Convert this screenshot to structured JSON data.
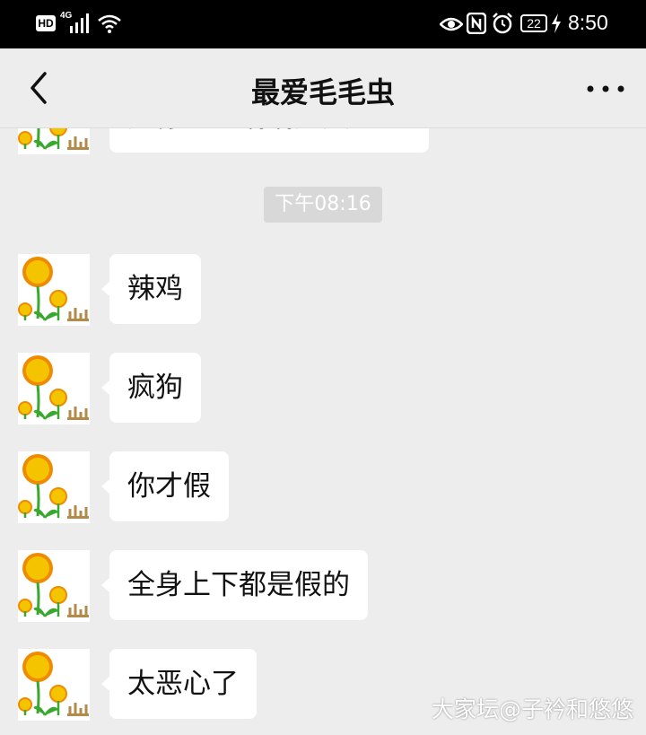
{
  "status_bar": {
    "hd_label": "HD",
    "network_label": "4G",
    "battery_level": "22",
    "time": "8:50"
  },
  "nav": {
    "title": "最爱毛毛虫",
    "back_icon": "chevron-left-icon",
    "more_icon": "more-dots-icon"
  },
  "chat": {
    "partial_message": "是你一直嘀嘀是天吧。",
    "timestamp": "下午08:16",
    "messages": [
      {
        "text": "辣鸡"
      },
      {
        "text": "疯狗"
      },
      {
        "text": "你才假"
      },
      {
        "text": "全身上下都是假的"
      },
      {
        "text": "太恶心了"
      }
    ]
  },
  "watermark": "大家坛@子衿和悠悠",
  "colors": {
    "background": "#ededed",
    "status_bar": "#000000",
    "bubble": "#ffffff",
    "timestamp_bg": "#d8d8d8",
    "sunflower_petal": "#f5c400",
    "sunflower_stem": "#3aa82e"
  }
}
